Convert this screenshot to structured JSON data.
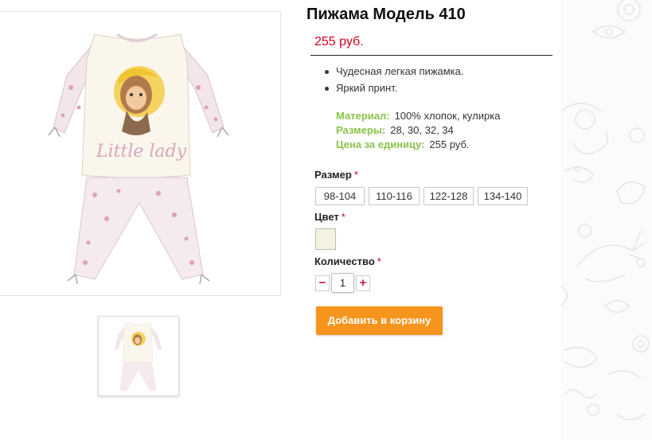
{
  "product": {
    "title": "Пижама Модель 410",
    "price": "255 руб.",
    "bullets": [
      "Чудесная легкая пижамка.",
      "Яркий принт."
    ],
    "specs": [
      {
        "label": "Материал:",
        "value": "100% хлопок, кулирка"
      },
      {
        "label": "Размеры:",
        "value": "28, 30, 32, 34"
      },
      {
        "label": "Цена за единицу:",
        "value": "255 руб."
      }
    ],
    "print_text": "Little lady"
  },
  "options": {
    "size_label": "Размер",
    "sizes": [
      "98-104",
      "110-116",
      "122-128",
      "134-140"
    ],
    "color_label": "Цвет",
    "color_swatch": "#f5f3e0",
    "quantity_label": "Количество",
    "quantity": "1",
    "required_mark": "*",
    "minus": "−",
    "plus": "+"
  },
  "cart": {
    "add_label": "Добавить в корзину"
  },
  "colors": {
    "price": "#d0021b",
    "spec_label": "#8bc34a",
    "button": "#f7941d",
    "qty_sign": "#c2185b"
  },
  "icons": [
    "product-photo-pajama",
    "product-thumbnail-pajama",
    "minus-icon",
    "plus-icon"
  ]
}
